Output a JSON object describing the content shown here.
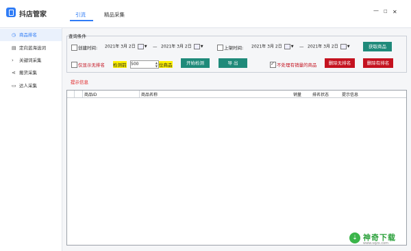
{
  "app": {
    "title": "抖店管家"
  },
  "tabs": [
    {
      "label": "引流"
    },
    {
      "label": "精品采集"
    }
  ],
  "window_controls": {
    "minimize": "—",
    "maximize": "□",
    "close": "✕"
  },
  "sidebar": {
    "items": [
      {
        "label": "商品排名",
        "icon": "clock-icon",
        "active": true
      },
      {
        "label": "定向蓝海选词",
        "icon": "doc-icon"
      },
      {
        "label": "关键词采集",
        "icon": "chevron-right-icon"
      },
      {
        "label": "搬货采集",
        "icon": "share-icon"
      },
      {
        "label": "达人采集",
        "icon": "folder-icon"
      }
    ]
  },
  "query": {
    "group_label": "查询条件",
    "create_time": {
      "label": "创建时间:",
      "from": "2021年 3月 2日",
      "to": "2021年 3月 2日",
      "separator": "—"
    },
    "shelf_time": {
      "label": "上架时间:",
      "from": "2021年 3月 2日",
      "to": "2021年 3月 2日",
      "separator": "—"
    },
    "get_products_button": "获取商品",
    "only_unranked": "仅显示无排名",
    "detect_prefix": "检测前",
    "detect_count": "500",
    "detect_suffix": "位商品",
    "start_detect_button": "开始检测",
    "export_button": "导 出",
    "no_sales_check": "不处理有销量的商品",
    "delete_unranked_button": "删除无排名",
    "delete_ranked_button": "删除有排名"
  },
  "tip_label": "提示信息",
  "table": {
    "columns": [
      "商品ID",
      "商品名称",
      "销量",
      "排名状态",
      "提示信息"
    ],
    "rows": []
  },
  "watermark": {
    "title": "神奇下载",
    "url": "www.sqzx.com"
  },
  "colors": {
    "accent": "#2f7cf6",
    "green_button": "#1f8a7a",
    "red_button": "#c4121f",
    "tip_red": "#e02020"
  }
}
